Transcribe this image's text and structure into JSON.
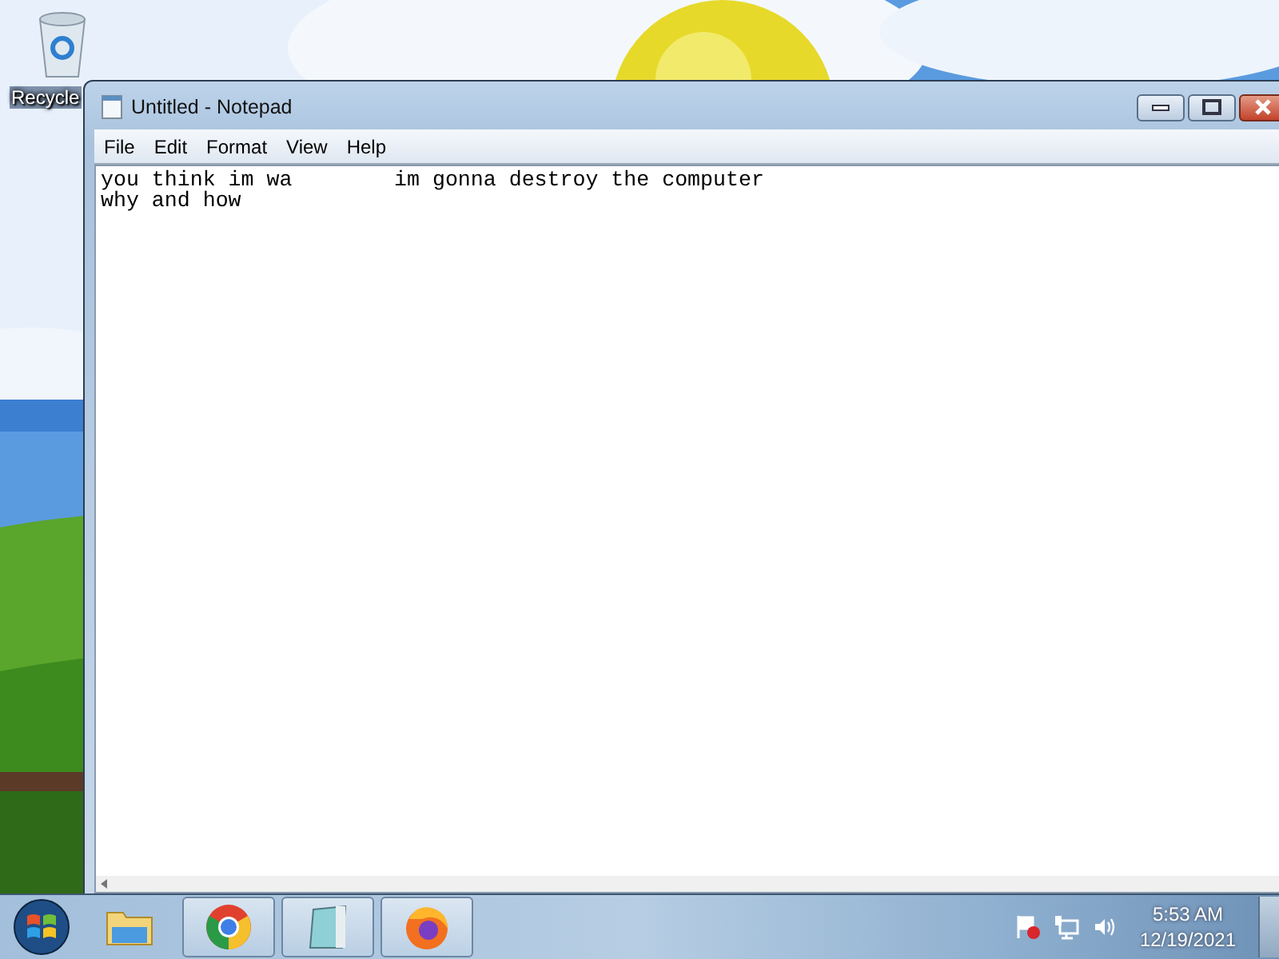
{
  "desktop_icons": [
    {
      "label": "Recycle"
    }
  ],
  "window": {
    "title": "Untitled - Notepad",
    "active": true
  },
  "menu": [
    {
      "label": "File"
    },
    {
      "label": "Edit"
    },
    {
      "label": "Format"
    },
    {
      "label": "View"
    },
    {
      "label": "Help"
    }
  ],
  "editor": {
    "lines": [
      "you think im wa        im gonna destroy the computer",
      "why and how"
    ]
  },
  "taskbar": {
    "apps": [
      {
        "kind": "folder",
        "pinned_only": true
      },
      {
        "kind": "browser",
        "pinned_only": false
      },
      {
        "kind": "notepad",
        "pinned_only": false
      },
      {
        "kind": "firefox",
        "pinned_only": false
      }
    ],
    "clock": {
      "time": "5:53 AM",
      "date": "12/19/2021"
    }
  }
}
